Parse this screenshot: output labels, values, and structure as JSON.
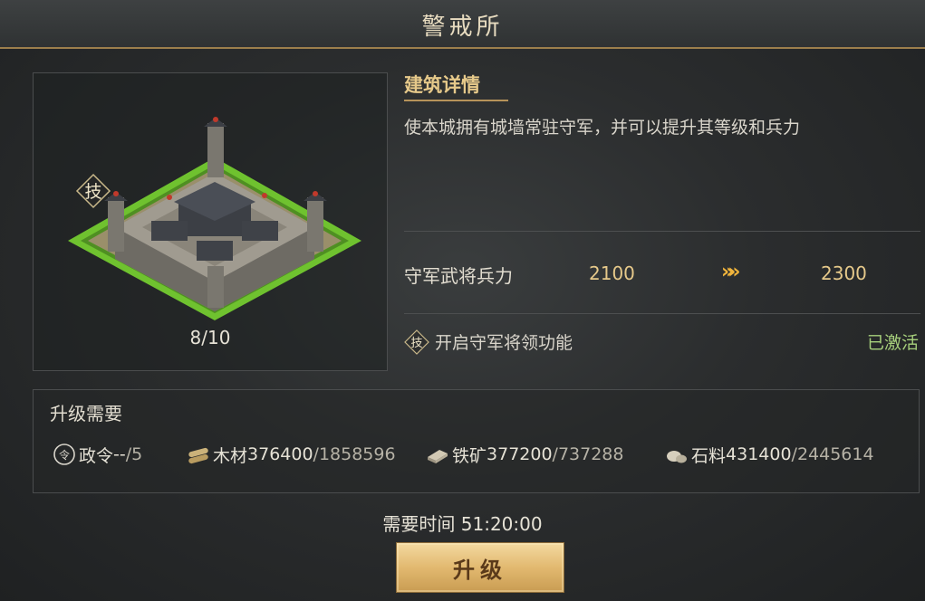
{
  "window": {
    "title": "警戒所"
  },
  "building": {
    "level": "8/10",
    "badge": "技"
  },
  "details": {
    "section_title": "建筑详情",
    "description": "使本城拥有城墙常驻守军，并可以提升其等级和兵力",
    "stat": {
      "label": "守军武将兵力",
      "current": "2100",
      "arrow": "»»",
      "next": "2300"
    },
    "feature": {
      "icon_text": "技",
      "label": "开启守军将领功能",
      "status": "已激活"
    }
  },
  "requirements": {
    "title": "升级需要",
    "items": [
      {
        "icon": "decree-icon",
        "name": "政令",
        "have": "--",
        "need": "/5"
      },
      {
        "icon": "wood-icon",
        "name": "木材",
        "have": "376400",
        "need": "/1858596"
      },
      {
        "icon": "iron-icon",
        "name": "铁矿",
        "have": "377200",
        "need": "/737288"
      },
      {
        "icon": "stone-icon",
        "name": "石料",
        "have": "431400",
        "need": "/2445614"
      }
    ]
  },
  "time": {
    "label": "需要时间",
    "value": "51:20:00"
  },
  "upgrade_button": {
    "label": "升级"
  },
  "colors": {
    "accent": "#e6c98a",
    "active": "#a7d07c",
    "arrow": "#f0b43c",
    "button": "#e2b970"
  }
}
